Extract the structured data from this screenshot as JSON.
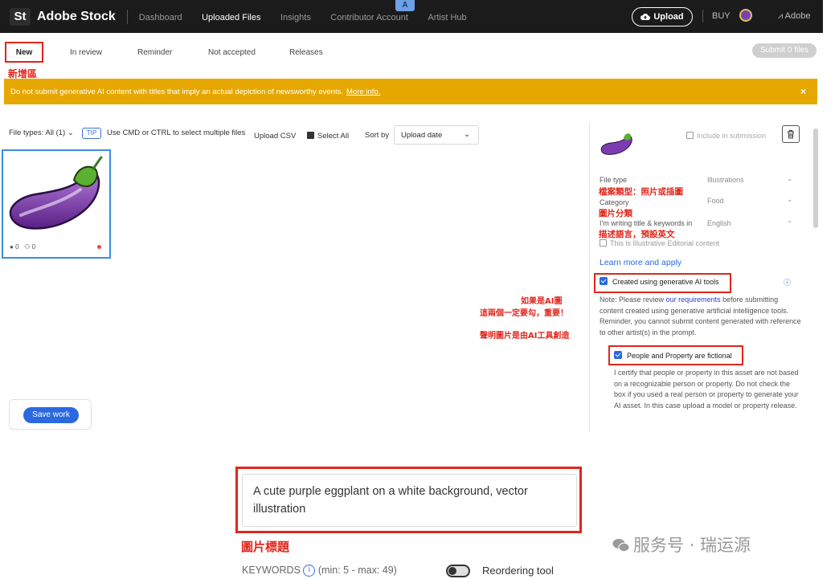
{
  "topbar": {
    "logo": "St",
    "brand": "Adobe Stock",
    "nav": [
      "Dashboard",
      "Uploaded Files",
      "Insights",
      "Contributor Account",
      "Artist Hub"
    ],
    "upload_label": "Upload",
    "buy_label": "BUY",
    "adobe_label": "Adobe",
    "badge": "A"
  },
  "tabs": [
    "New",
    "In review",
    "Reminder",
    "Not accepted",
    "Releases"
  ],
  "submit_label": "Submit 0 files",
  "annotations": {
    "new_area": "新增區",
    "file_type_note": "檔案類型：照片或插圖",
    "category_note": "圖片分類",
    "language_note": "描述語言，預設英文",
    "ai_note_1": "如果是AI圖",
    "ai_note_2": "這兩個一定要勾，重要！",
    "ai_note_3": "聲明圖片是由AI工具創造",
    "title_note": "圖片標題"
  },
  "warning": {
    "text": "Do not submit generative AI content with titles that imply an actual depiction of newsworthy events.",
    "link": "More info.",
    "close": "×"
  },
  "filters": {
    "file_types": "File types: All (1)",
    "tip": "TIP",
    "tip_text": "Use CMD or CTRL to select multiple files",
    "upload_csv": "Upload CSV",
    "select_all": "Select All",
    "sort_by": "Sort by",
    "sort_value": "Upload date"
  },
  "card": {
    "tags_count": "0",
    "people_count": "0"
  },
  "save_label": "Save work",
  "panel": {
    "include_label": "Include in submission",
    "file_type_label": "File type",
    "file_type_value": "Illustrations",
    "category_label": "Category",
    "category_value": "Food",
    "language_label": "I'm writing title & keywords in",
    "language_value": "English",
    "editorial_label": "This is Illustrative Editorial content",
    "learn_more": "Learn more and apply",
    "gen_ai_label": "Created using generative AI tools",
    "note_prefix": "Note: Please review",
    "note_link": "our requirements",
    "note_suffix": "before submitting content created using generative artificial intelligence tools. Reminder, you cannot submit content generated with reference to other artist(s) in the prompt.",
    "fictional_label": "People and Property are fictional",
    "certify_text": "I certify that people or property in this asset are not based on a recognizable person or property. Do not check the box if you used a real person or property to generate your AI asset. In this case upload a model or property release."
  },
  "title_field": {
    "value": "A cute purple eggplant on a white background, vector illustration"
  },
  "keywords": {
    "label": "KEYWORDS",
    "range": "(min: 5 - max: 49)",
    "reorder_label": "Reordering tool"
  },
  "watermark": "服务号 · 瑞运源",
  "colors": {
    "accent": "#2a69e0",
    "warning": "#e6a800",
    "annotation": "#e0261c",
    "topbar": "#1b1b1b"
  }
}
